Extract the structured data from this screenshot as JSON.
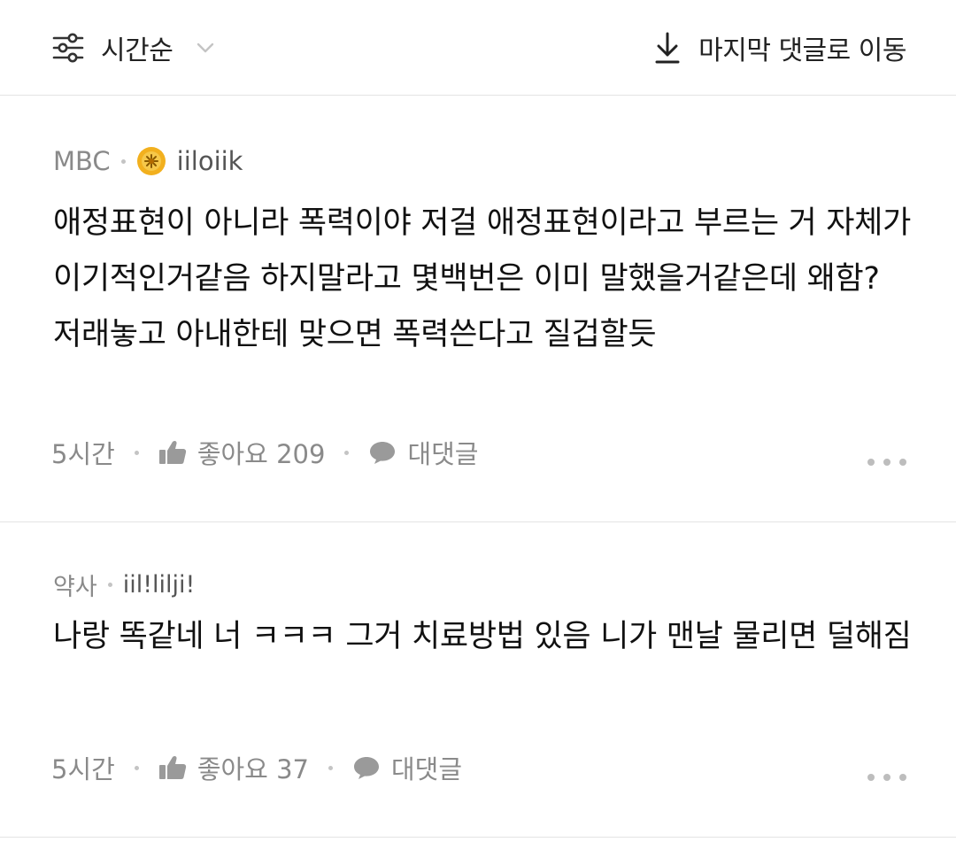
{
  "toolbar": {
    "sort_label": "시간순",
    "jump_label": "마지막 댓글로 이동",
    "sort_icon": "sliders-icon",
    "chevron_icon": "chevron-down-icon",
    "jump_icon": "download-arrow-icon"
  },
  "comments": [
    {
      "source": "MBC",
      "nickname": "iiloiik",
      "has_badge": true,
      "badge_color": "#f2b01e",
      "text": "애정표현이 아니라 폭력이야 저걸 애정표현이라고 부르는 거 자체가 이기적인거같음 하지말라고 몇백번은 이미 말했을거같은데 왜함? 저래놓고 아내한테 맞으면 폭력쓴다고 질겁할듯",
      "time": "5시간",
      "like_label": "좋아요 209",
      "reply_label": "대댓글"
    },
    {
      "source": "약사",
      "nickname": "iil!lilji!",
      "has_badge": false,
      "text": "나랑 똑같네 너 ㅋㅋㅋ 그거 치료방법 있음 니가 맨날 물리면 덜해짐",
      "time": "5시간",
      "like_label": "좋아요 37",
      "reply_label": "대댓글"
    }
  ],
  "colors": {
    "text_primary": "#111111",
    "text_secondary": "#8a8a8a",
    "divider": "#e4e4e4"
  }
}
